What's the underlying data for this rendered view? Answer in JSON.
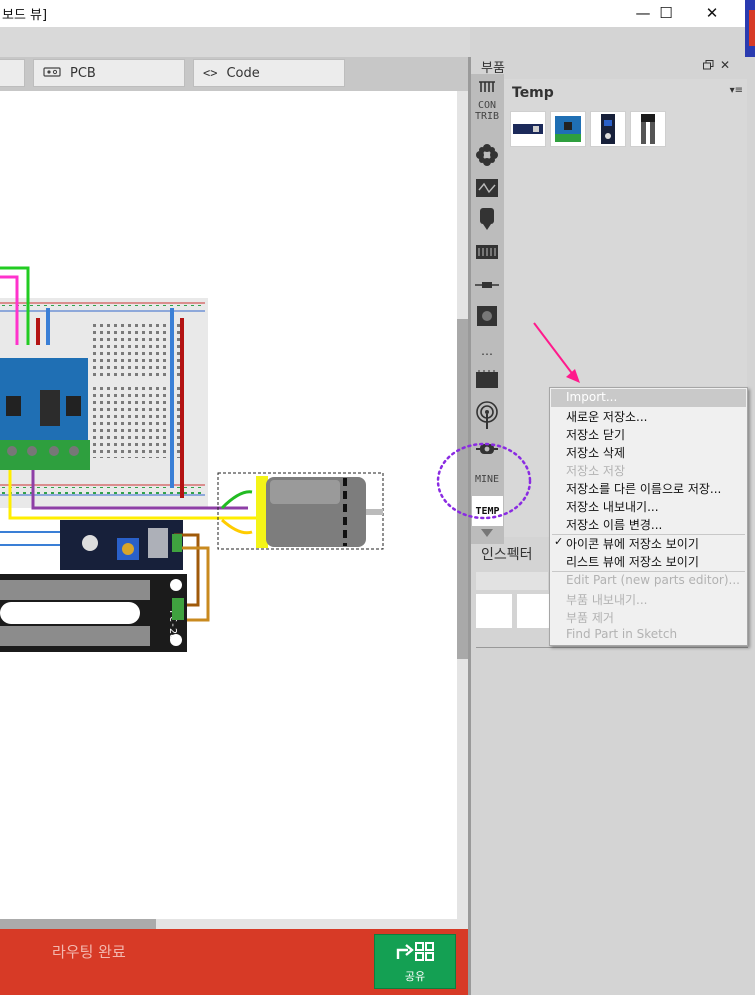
{
  "window": {
    "title_fragment": "보드 뷰]",
    "minimize_glyph": "—",
    "maximize_glyph": "☐",
    "close_glyph": "✕"
  },
  "tabs": [
    {
      "label": "PCB",
      "icon": "pcb-icon"
    },
    {
      "label": "Code",
      "icon": "code-icon",
      "icon_glyph": "<>"
    }
  ],
  "bottom_bar": {
    "routing_status": "라우팅 완료",
    "share_label": "공유",
    "color": "#d73a26"
  },
  "parts_panel": {
    "title": "부품",
    "bins": [
      {
        "label": "CON\nTRIB",
        "icon": "contrib-icon"
      },
      {
        "label": "MINE",
        "icon": "mine-icon"
      },
      {
        "label": "TEMP",
        "icon": "temp-icon",
        "selected": true
      }
    ],
    "more_glyph": "…",
    "current_bin": "Temp",
    "bin_menu_glyph": "▾≡",
    "parts": [
      {
        "icon": "module-board-thumb"
      },
      {
        "icon": "driver-board-thumb"
      },
      {
        "icon": "sensor-module-thumb"
      },
      {
        "icon": "soil-probe-thumb"
      }
    ]
  },
  "inspector": {
    "title": "인스펙터"
  },
  "context_menu": {
    "items": [
      {
        "label": "Import...",
        "state": "highlighted"
      },
      {
        "label": "새로운 저장소...",
        "state": "enabled"
      },
      {
        "label": "저장소 닫기",
        "state": "enabled"
      },
      {
        "label": "저장소 삭제",
        "state": "enabled"
      },
      {
        "label": "저장소 저장",
        "state": "disabled"
      },
      {
        "label": "저장소를 다른 이름으로 저장...",
        "state": "enabled"
      },
      {
        "label": "저장소 내보내기...",
        "state": "enabled"
      },
      {
        "label": "저장소 이름 변경...",
        "state": "enabled"
      },
      {
        "label": "아이콘 뷰에 저장소 보이기",
        "state": "checked"
      },
      {
        "label": "리스트 뷰에 저장소 보이기",
        "state": "enabled"
      },
      {
        "label": "Edit Part (new parts editor)...",
        "state": "disabled"
      },
      {
        "label": "부품 내보내기...",
        "state": "disabled"
      },
      {
        "label": "부품 제거",
        "state": "disabled"
      },
      {
        "label": "Find Part in Sketch",
        "state": "disabled"
      }
    ]
  },
  "circuit": {
    "motor_label": "",
    "sensor_label": "FC-28"
  },
  "annotations": {
    "arrow_color": "#ff1a8c",
    "circle_color": "#8a2be2"
  }
}
